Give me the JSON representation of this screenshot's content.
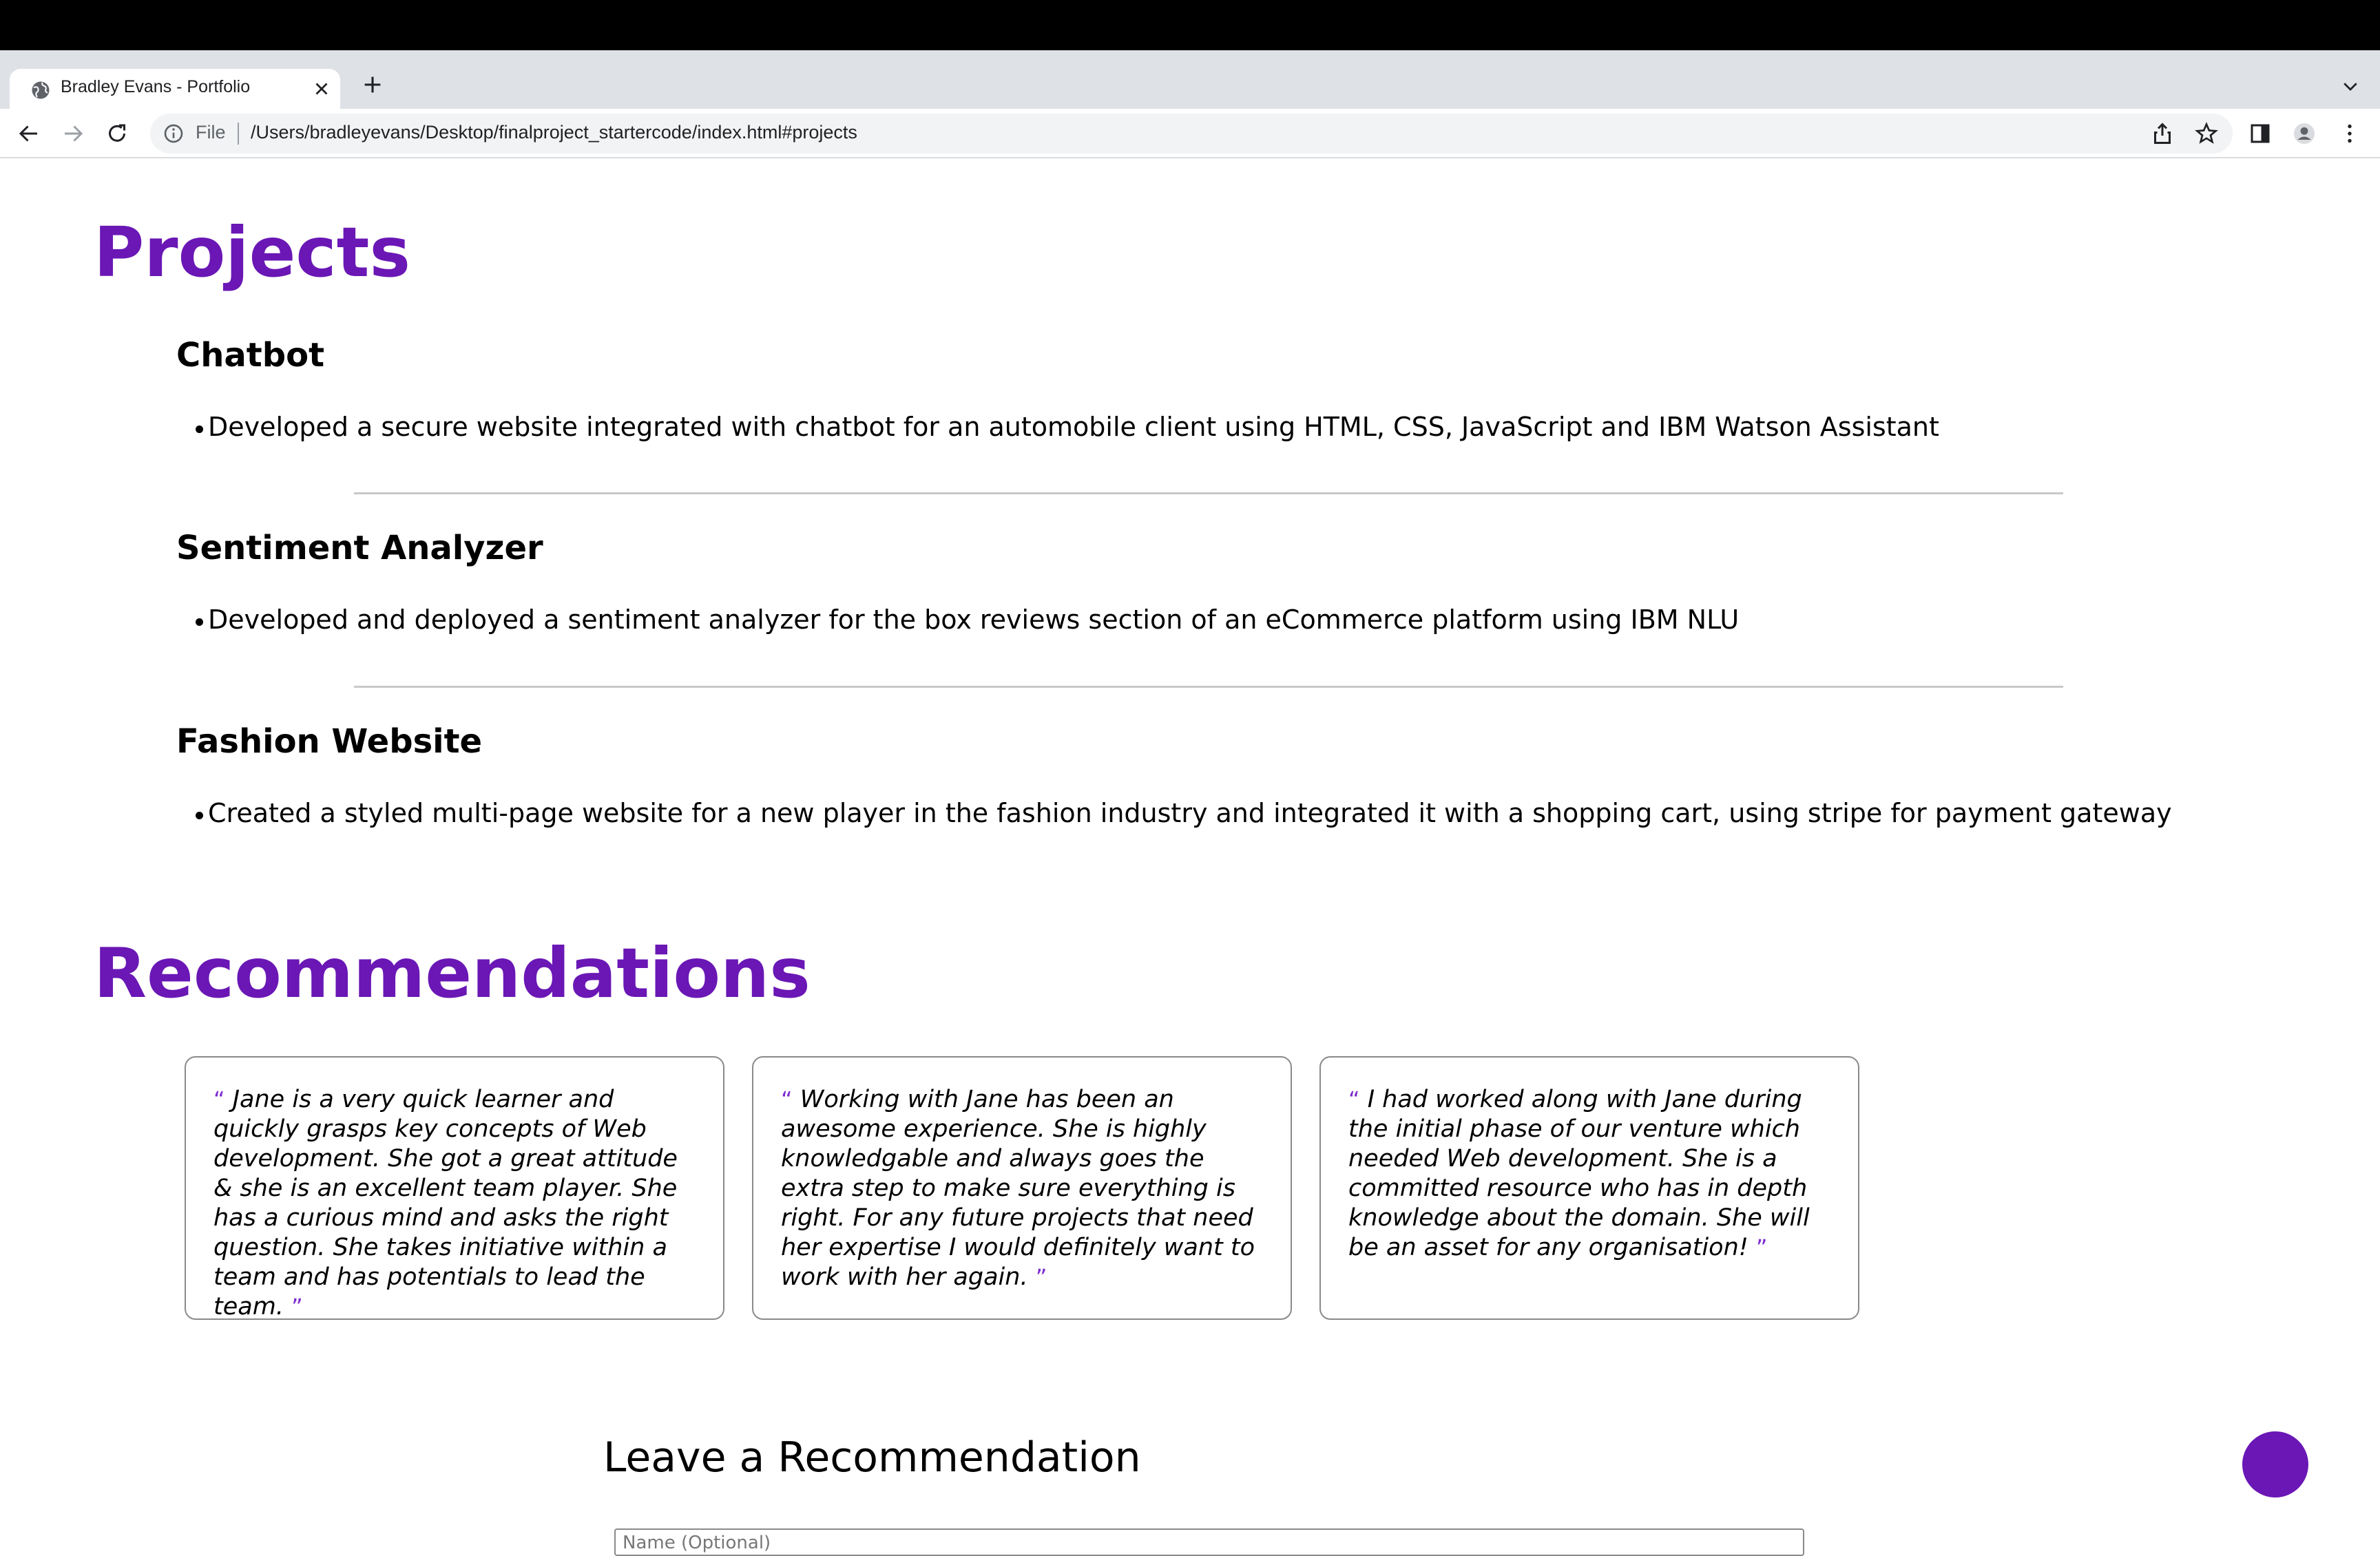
{
  "browser": {
    "tab_title": "Bradley Evans - Portfolio",
    "omnibox_scheme": "File",
    "url": "/Users/bradleyevans/Desktop/finalproject_startercode/index.html#projects"
  },
  "projects": {
    "heading": "Projects",
    "items": [
      {
        "title": "Chatbot",
        "bullet": "Developed a secure website integrated with chatbot for an automobile client using HTML, CSS, JavaScript and IBM Watson Assistant"
      },
      {
        "title": "Sentiment Analyzer",
        "bullet": "Developed and deployed a sentiment analyzer for the box reviews section of an eCommerce platform using IBM NLU"
      },
      {
        "title": "Fashion Website",
        "bullet": "Created a styled multi-page website for a new player in the fashion industry and integrated it with a shopping cart, using stripe for payment gateway"
      }
    ]
  },
  "recommendations": {
    "heading": "Recommendations",
    "open_quote": "“",
    "close_quote": "”",
    "items": [
      {
        "text": "Jane is a very quick learner and quickly grasps key concepts of Web development. She got a great attitude & she is an excellent team player. She has a curious mind and asks the right question. She takes initiative within a team and has potentials to lead the team."
      },
      {
        "text": "Working with Jane has been an awesome experience. She is highly knowledgable and always goes the extra step to make sure everything is right. For any future projects that need her expertise I would definitely want to work with her again."
      },
      {
        "text": "I had worked along with Jane during the initial phase of our venture which needed Web development. She is a committed resource who has in depth knowledge about the domain. She will be an asset for any organisation!"
      }
    ]
  },
  "leave_recommendation": {
    "heading": "Leave a Recommendation",
    "name_placeholder": "Name (Optional)"
  },
  "colors": {
    "accent": "#6a17b5"
  }
}
